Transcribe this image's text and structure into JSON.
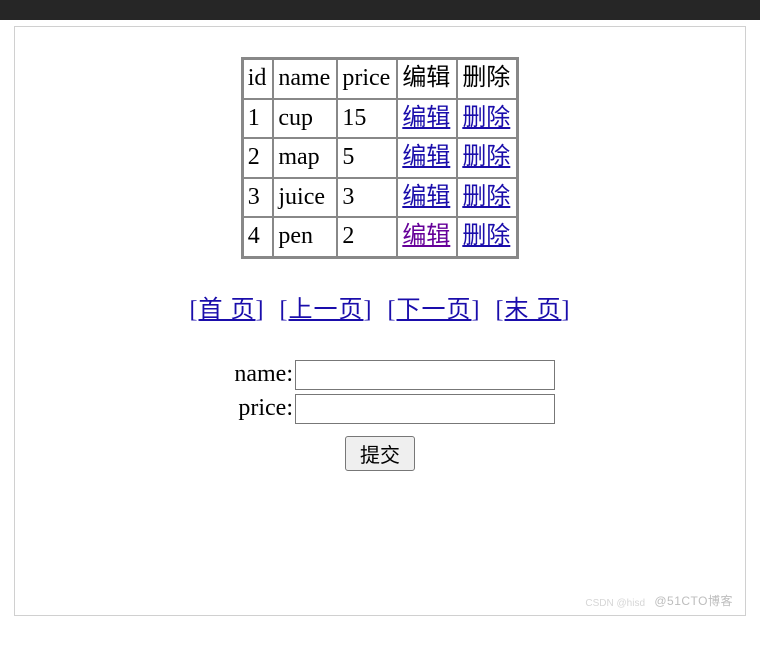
{
  "table": {
    "headers": {
      "id": "id",
      "name": "name",
      "price": "price",
      "edit": "编辑",
      "delete": "删除"
    },
    "rows": [
      {
        "id": "1",
        "name": "cup",
        "price": "15",
        "edit": "编辑",
        "delete": "删除",
        "editVisited": false
      },
      {
        "id": "2",
        "name": "map",
        "price": "5",
        "edit": "编辑",
        "delete": "删除",
        "editVisited": false
      },
      {
        "id": "3",
        "name": "juice",
        "price": "3",
        "edit": "编辑",
        "delete": "删除",
        "editVisited": false
      },
      {
        "id": "4",
        "name": "pen",
        "price": "2",
        "edit": "编辑",
        "delete": "删除",
        "editVisited": true
      }
    ]
  },
  "pagination": {
    "first": "首 页",
    "prev": "上一页",
    "next": "下一页",
    "last": "末 页"
  },
  "form": {
    "name_label": "name:",
    "price_label": "price:",
    "name_value": "",
    "price_value": "",
    "submit_label": "提交"
  },
  "watermark": {
    "right": "@51CTO博客",
    "left": "CSDN @hisd"
  }
}
